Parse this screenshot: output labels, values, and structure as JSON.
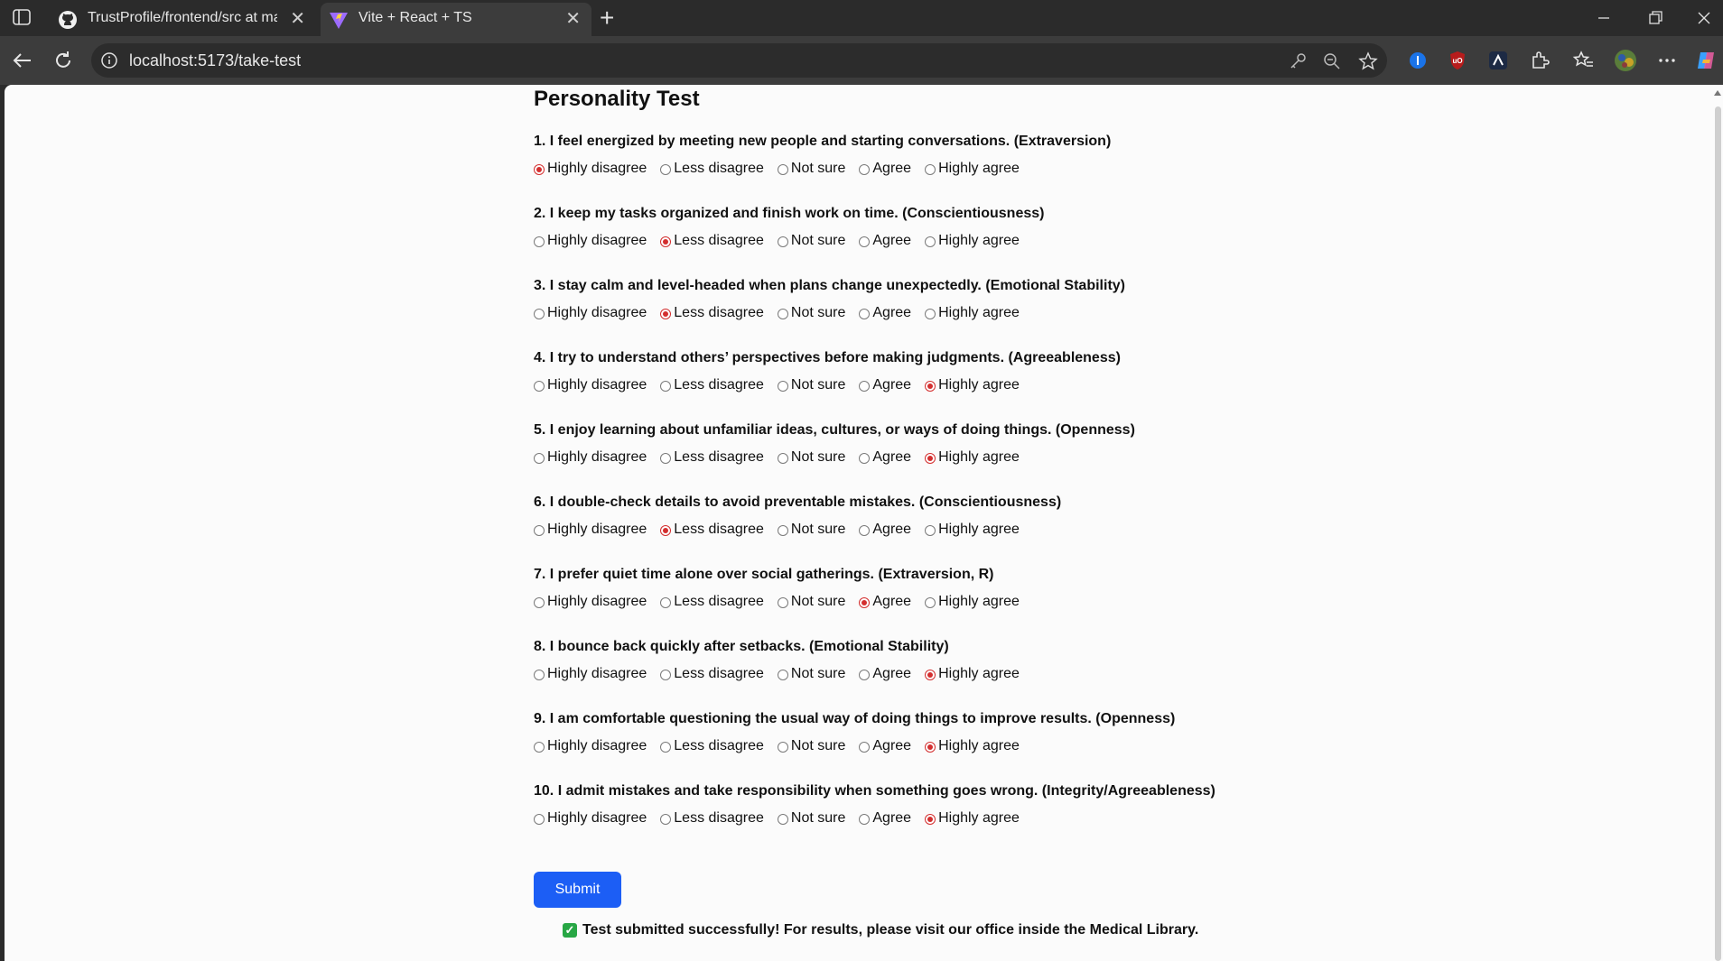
{
  "browser": {
    "tabs": [
      {
        "title": "TrustProfile/frontend/src at main",
        "icon": "github-icon",
        "active": false
      },
      {
        "title": "Vite + React + TS",
        "icon": "vite-icon",
        "active": true
      }
    ],
    "url": "localhost:5173/take-test"
  },
  "page": {
    "title": "Personality Test",
    "options": [
      "Highly disagree",
      "Less disagree",
      "Not sure",
      "Agree",
      "Highly agree"
    ],
    "questions": [
      {
        "text": "1. I feel energized by meeting new people and starting conversations. (Extraversion)",
        "selected": "Highly disagree"
      },
      {
        "text": "2. I keep my tasks organized and finish work on time. (Conscientiousness)",
        "selected": "Less disagree"
      },
      {
        "text": "3. I stay calm and level-headed when plans change unexpectedly. (Emotional Stability)",
        "selected": "Less disagree"
      },
      {
        "text": "4. I try to understand others’ perspectives before making judgments. (Agreeableness)",
        "selected": "Highly agree"
      },
      {
        "text": "5. I enjoy learning about unfamiliar ideas, cultures, or ways of doing things. (Openness)",
        "selected": "Highly agree"
      },
      {
        "text": "6. I double-check details to avoid preventable mistakes. (Conscientiousness)",
        "selected": "Less disagree"
      },
      {
        "text": "7. I prefer quiet time alone over social gatherings. (Extraversion, R)",
        "selected": "Agree"
      },
      {
        "text": "8. I bounce back quickly after setbacks. (Emotional Stability)",
        "selected": "Highly agree"
      },
      {
        "text": "9. I am comfortable questioning the usual way of doing things to improve results. (Openness)",
        "selected": "Highly agree"
      },
      {
        "text": "10. I admit mistakes and take responsibility when something goes wrong. (Integrity/Agreeableness)",
        "selected": "Highly agree"
      }
    ],
    "submit_label": "Submit",
    "success_message": "Test submitted successfully! For results, please visit our office inside the Medical Library.",
    "colors": {
      "accent": "#1c5ef5",
      "radio_checked": "#d32f2f",
      "success": "#28a745"
    }
  }
}
